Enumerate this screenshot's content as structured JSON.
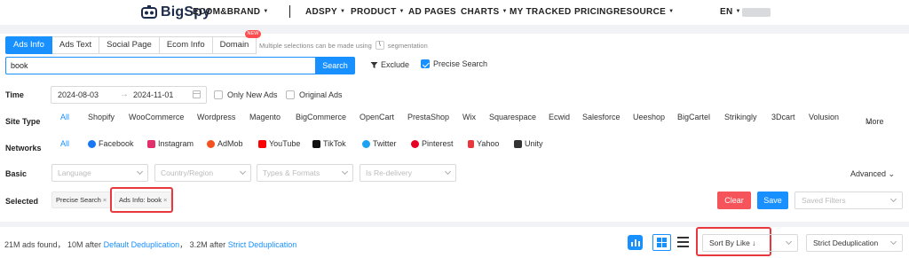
{
  "nav": {
    "logo_text": "BigSpy",
    "items": [
      "ECOM&BRAND",
      "ADSPY",
      "PRODUCT",
      "AD PAGES",
      "CHARTS",
      "MY TRACKED",
      "PRICING",
      "RESOURCE"
    ],
    "language": "EN"
  },
  "tabs": [
    "Ads Info",
    "Ads Text",
    "Social Page",
    "Ecom Info",
    "Domain"
  ],
  "new_badge": "NEW",
  "hint": {
    "before": "Multiple selections can be made using",
    "key": "\\",
    "after": "segmentation"
  },
  "search": {
    "value": "book",
    "button": "Search",
    "exclude": "Exclude",
    "precise": "Precise Search"
  },
  "time": {
    "label": "Time",
    "start": "2024-08-03",
    "end": "2024-11-01",
    "only_new": "Only New Ads",
    "original": "Original Ads"
  },
  "site_type": {
    "label": "Site Type",
    "items": [
      "All",
      "Shopify",
      "WooCommerce",
      "Wordpress",
      "Magento",
      "BigCommerce",
      "OpenCart",
      "PrestaShop",
      "Wix",
      "Squarespace",
      "Ecwid",
      "Salesforce",
      "Ueeshop",
      "BigCartel",
      "Strikingly",
      "3Dcart",
      "Volusion"
    ],
    "more": "More"
  },
  "networks": {
    "label": "Networks",
    "all": "All",
    "items": [
      "Facebook",
      "Instagram",
      "AdMob",
      "YouTube",
      "TikTok",
      "Twitter",
      "Pinterest",
      "Yahoo",
      "Unity"
    ]
  },
  "basic": {
    "label": "Basic",
    "selects": [
      "Language",
      "Country/Region",
      "Types & Formats",
      "Is Re-delivery"
    ],
    "advanced": "Advanced"
  },
  "selected": {
    "label": "Selected",
    "tags": [
      "Precise Search",
      "Ads Info: book"
    ],
    "clear": "Clear",
    "save": "Save",
    "saved_filters": "Saved Filters"
  },
  "results": {
    "found": "21M ads found， 10M after",
    "default_link": "Default Deduplication",
    "mid": "， 3.2M after",
    "strict_link": "Strict Deduplication",
    "sort": "Sort By Like ↓",
    "dedup": "Strict Deduplication"
  },
  "colors": {
    "accent": "#1890ff",
    "highlight": "#e8383d",
    "clear": "#f5545a"
  }
}
